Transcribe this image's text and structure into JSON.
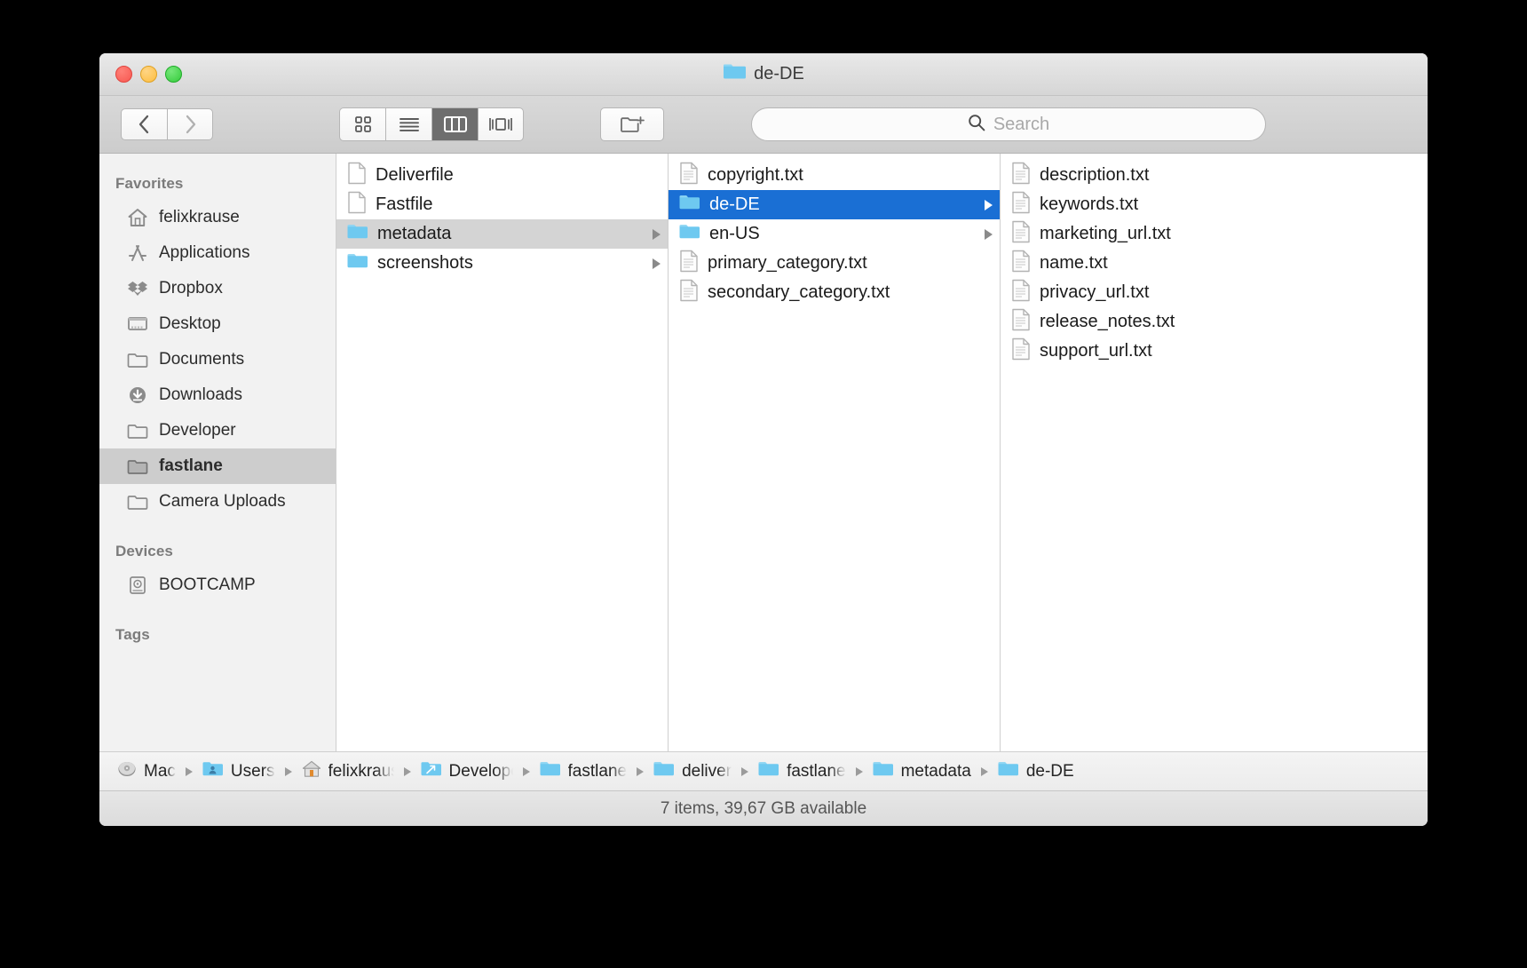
{
  "window": {
    "title": "de-DE",
    "title_icon": "folder-icon",
    "traffic_lights": [
      "close-button",
      "minimize-button",
      "zoom-button"
    ]
  },
  "toolbar": {
    "back_label": "‹",
    "forward_label": "›",
    "view_modes": [
      {
        "id": "icon-view",
        "label": "icon-grid-icon",
        "active": false
      },
      {
        "id": "list-view",
        "label": "list-icon",
        "active": false
      },
      {
        "id": "column-view",
        "label": "columns-icon",
        "active": true
      },
      {
        "id": "coverflow-view",
        "label": "coverflow-icon",
        "active": false
      }
    ],
    "new_folder_label": "new-folder-icon",
    "search": {
      "placeholder": "Search",
      "value": "",
      "icon": "search-icon"
    }
  },
  "sidebar": {
    "sections": [
      {
        "header": "Favorites",
        "items": [
          {
            "label": "felixkrause",
            "icon": "home-icon",
            "selected": false
          },
          {
            "label": "Applications",
            "icon": "applications-icon",
            "selected": false
          },
          {
            "label": "Dropbox",
            "icon": "dropbox-icon",
            "selected": false
          },
          {
            "label": "Desktop",
            "icon": "desktop-icon",
            "selected": false
          },
          {
            "label": "Documents",
            "icon": "folder-icon",
            "selected": false
          },
          {
            "label": "Downloads",
            "icon": "downloads-icon",
            "selected": false
          },
          {
            "label": "Developer",
            "icon": "folder-icon",
            "selected": false
          },
          {
            "label": "fastlane",
            "icon": "folder-icon",
            "selected": true
          },
          {
            "label": "Camera Uploads",
            "icon": "folder-icon",
            "selected": false
          }
        ]
      },
      {
        "header": "Devices",
        "items": [
          {
            "label": "BOOTCAMP",
            "icon": "harddisk-icon",
            "selected": false
          }
        ]
      },
      {
        "header": "Tags",
        "items": []
      }
    ]
  },
  "columns": [
    {
      "id": "column-1",
      "rows": [
        {
          "label": "Deliverfile",
          "kind": "file",
          "selected": "none",
          "arrow": false
        },
        {
          "label": "Fastfile",
          "kind": "file",
          "selected": "none",
          "arrow": false
        },
        {
          "label": "metadata",
          "kind": "folder",
          "selected": "gray",
          "arrow": true
        },
        {
          "label": "screenshots",
          "kind": "folder",
          "selected": "none",
          "arrow": true
        }
      ]
    },
    {
      "id": "column-2",
      "rows": [
        {
          "label": "copyright.txt",
          "kind": "textfile",
          "selected": "none",
          "arrow": false
        },
        {
          "label": "de-DE",
          "kind": "folder",
          "selected": "blue",
          "arrow": true
        },
        {
          "label": "en-US",
          "kind": "folder",
          "selected": "none",
          "arrow": true
        },
        {
          "label": "primary_category.txt",
          "kind": "textfile",
          "selected": "none",
          "arrow": false
        },
        {
          "label": "secondary_category.txt",
          "kind": "textfile",
          "selected": "none",
          "arrow": false
        }
      ]
    },
    {
      "id": "column-3",
      "rows": [
        {
          "label": "description.txt",
          "kind": "textfile",
          "selected": "none",
          "arrow": false
        },
        {
          "label": "keywords.txt",
          "kind": "textfile",
          "selected": "none",
          "arrow": false
        },
        {
          "label": "marketing_url.txt",
          "kind": "textfile",
          "selected": "none",
          "arrow": false
        },
        {
          "label": "name.txt",
          "kind": "textfile",
          "selected": "none",
          "arrow": false
        },
        {
          "label": "privacy_url.txt",
          "kind": "textfile",
          "selected": "none",
          "arrow": false
        },
        {
          "label": "release_notes.txt",
          "kind": "textfile",
          "selected": "none",
          "arrow": false
        },
        {
          "label": "support_url.txt",
          "kind": "textfile",
          "selected": "none",
          "arrow": false
        }
      ]
    }
  ],
  "pathbar": {
    "crumbs": [
      {
        "label": "Mac",
        "icon": "harddisk-icon",
        "truncated": true
      },
      {
        "label": "Users",
        "icon": "users-folder-icon",
        "truncated": true
      },
      {
        "label": "felixkrause",
        "icon": "home-icon",
        "truncated": true
      },
      {
        "label": "Developer",
        "icon": "developer-folder-icon",
        "truncated": true
      },
      {
        "label": "fastlane",
        "icon": "folder-icon",
        "truncated": true
      },
      {
        "label": "deliver",
        "icon": "folder-icon",
        "truncated": true
      },
      {
        "label": "fastlane",
        "icon": "folder-icon",
        "truncated": true
      },
      {
        "label": "metadata",
        "icon": "folder-icon",
        "truncated": false
      },
      {
        "label": "de-DE",
        "icon": "folder-icon",
        "truncated": false
      }
    ]
  },
  "statusbar": {
    "text": "7 items, 39,67 GB available"
  },
  "colors": {
    "selection_blue": "#1a6fd4",
    "selection_gray": "#d4d4d4",
    "folder_blue": "#6ec9f0",
    "sidebar_bg": "#f2f2f2"
  }
}
